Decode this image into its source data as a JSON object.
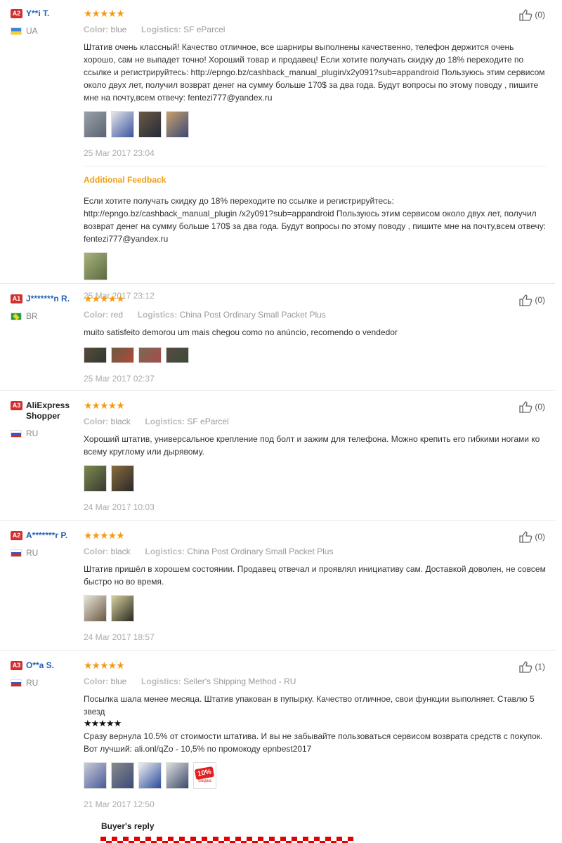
{
  "colors": {
    "accent": "#f39c12",
    "username": "#1f62b9",
    "badge": "#d32f2f"
  },
  "labels": {
    "color": "Color:",
    "logistics": "Logistics:",
    "additional_feedback": "Additional Feedback",
    "buyers_reply": "Buyer's reply"
  },
  "reviews": [
    {
      "badge": "A2",
      "name": "Y**i T.",
      "country": "UA",
      "stars": "★★★★★",
      "color": "blue",
      "logistics": "SF eParcel",
      "likes": "(0)",
      "text": "Штатив очень классный! Качество отличное, все шарниры выполнены качественно, телефон держится очень хорошо, сам не выпадет точно! Хороший товар и продавец! Если хотите получать скидку до 18% переходите по ссылке и регистрируйтесь: http://epngo.bz/cashback_manual_plugin/x2y091?sub=appandroid Пользуюсь этим сервисом около двух лет, получил возврат денег на сумму больше 170$ за два года. Будут вопросы по этому поводу , пишите мне на почту,всем отвечу: fentezi777@yandex.ru",
      "date": "25 Mar 2017 23:04",
      "additional_text": "Если хотите получать скидку до 18% переходите по ссылке и регистрируйтесь: http://epngo.bz/cashback_manual_plugin /x2y091?sub=appandroid Пользуюсь этим сервисом около двух лет, получил возврат денег на сумму больше 170$ за два года. Будут вопросы по этому поводу , пишите мне на почту,всем отвечу: fentezi777@yandex.ru",
      "additional_date": "25 Mar 2017 23:12"
    },
    {
      "badge": "A1",
      "name": "J*******n R.",
      "country": "BR",
      "stars": "★★★★★",
      "color": "red",
      "logistics": "China Post Ordinary Small Packet Plus",
      "likes": "(0)",
      "text": "muito satisfeito demorou um mais chegou como no anúncio, recomendo o vendedor",
      "date": "25 Mar 2017 02:37"
    },
    {
      "badge": "A3",
      "name": "AliExpress Shopper",
      "country": "RU",
      "stars": "★★★★★",
      "color": "black",
      "logistics": "SF eParcel",
      "likes": "(0)",
      "text": "Хороший штатив, универсальное крепление под болт и зажим для телефона. Можно крепить его гибкими ногами ко всему круглому или дырявому.",
      "date": "24 Mar 2017 10:03"
    },
    {
      "badge": "A2",
      "name": "A*******r P.",
      "country": "RU",
      "stars": "★★★★★",
      "color": "black",
      "logistics": "China Post Ordinary Small Packet Plus",
      "likes": "(0)",
      "text": "Штатив пришёл в хорошем состоянии. Продавец отвечал и проявлял инициативу сам. Доставкой доволен, не совсем быстро но во время.",
      "date": "24 Mar 2017 18:57"
    },
    {
      "badge": "A3",
      "name": "O**a S.",
      "country": "RU",
      "stars": "★★★★★",
      "color": "blue",
      "logistics": "Seller's Shipping Method - RU",
      "likes": "(1)",
      "text": "Посылка шала менее месяца. Штатив упакован в пупырку. Качество отличное, свои функции выполняет. Ставлю 5 звезд",
      "text_stars": "★★★★★",
      "text2": "Сразу вернула 10.5% от стоимости штатива. И вы не забывайте пользоваться сервисом возврата средств с покупок. Вот лучший: ali.onl/qZo - 10,5% по промокоду epnbest2017",
      "date": "21 Mar 2017 12:50",
      "promo_tag": "10%",
      "promo_sub": "скидка"
    }
  ]
}
